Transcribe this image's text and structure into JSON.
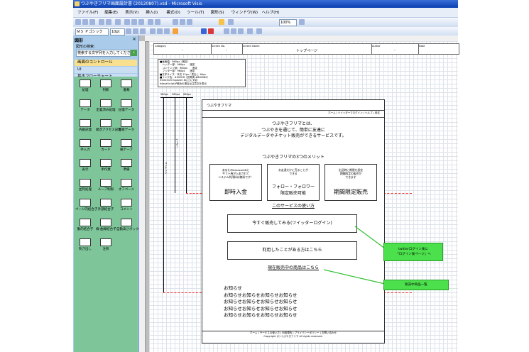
{
  "window": {
    "title": "つぶやきフリマ画面設計書 (20120807).vsd - Microsoft Visio"
  },
  "menu": [
    "ファイル(F)",
    "編集(E)",
    "表示(V)",
    "挿入(I)",
    "書式(O)",
    "ツール(T)",
    "図形(S)",
    "ウィンドウ(W)",
    "ヘルプ(H)"
  ],
  "toolbar": {
    "font_name": "ＭＳ Ｐゴシック",
    "font_size": "10pt",
    "zoom": "100%"
  },
  "shapes_pane": {
    "title": "図形",
    "find_label": "図形の検索:",
    "find_placeholder": "検索する文字列を入力してください",
    "stencils": [
      "画面のコントロール",
      "UI",
      "基本フローチャート"
    ],
    "shapes": [
      "処理",
      "判断",
      "書類",
      "データ",
      "定義済み処理",
      "記憶データ",
      "内部記憶",
      "順次アクセス記憶",
      "直接データ",
      "手入力",
      "カード",
      "紙テープ",
      "表示",
      "手作業",
      "準備",
      "並列処理",
      "ループ制限",
      "オフページ",
      "ページ内結合子",
      "外部結合子",
      "コメント",
      "動的結合子",
      "線-曲線結合子",
      "自動高さボックス",
      "吹き出し",
      "注釈"
    ]
  },
  "header_table": {
    "cols": [
      {
        "key": "Category",
        "value": "-"
      },
      {
        "key": "Screen No.",
        "value": "-"
      },
      {
        "key": "Screen Name",
        "value": "トップページ"
      },
      {
        "key": "Author",
        "value": "-"
      },
      {
        "key": "Date",
        "value": ""
      }
    ]
  },
  "spec_box": [
    "■画面幅：960px（固定）",
    "　ヘッダー部：960px　　固定",
    "　コンテンツ部：960px　　固定",
    "　フッター部：960px　　固定",
    "■文字サイズ：本文 12px / 見出し 16px",
    "■リンク色：#0000ff（訪問済 #800080）",
    "※Internet Explorer 8以上に対応",
    "※JavaScriptが無効の場合は注意文を表示"
  ],
  "mockup": {
    "logo": "つぶやきフリマ",
    "nav": "ホーム | ツイッターでログイン | ヘルプ | 設定",
    "intro": [
      "つぶやきフリマとは、",
      "つぶやきを通じて、簡単に友達に",
      "デジタルデータやチケット販売ができるサービスです。"
    ],
    "merit_title": "つぶやきフリマの3つのメリット",
    "merits": [
      {
        "text": "あなたのAmazonIDに\nギフト券が入金されて\nシステム利用料は無料です！",
        "title": "即時入金"
      },
      {
        "text": "お友達だけに売ることが\nできる",
        "title": "フォロー・フォロワー\n限定販売可能"
      },
      {
        "text": "出品時に期限を設定\n期間限定の販売が\nできます",
        "title": "期間限定販売"
      }
    ],
    "howto": "このサービスの使い方",
    "btn_sell": "今すぐ販売してみる(ツイッターログイン)",
    "btn_login": "利用したことがある方はこちら",
    "items_link": "現在販売中の商品はこちら",
    "news": [
      "お知らせ",
      "お知らせお知らせお知らせお知らせ",
      "お知らせお知らせお知らせお知らせ",
      "お知らせお知らせお知らせお知らせ",
      "お知らせお知らせお知らせお知らせ"
    ],
    "footer": [
      "ホーム | サービスの使い方 | 利用規約 | プライバシーポリシー | お問い合わせ",
      "Copyright (C) つぶやきフリマ All rights reserved."
    ]
  },
  "dimensions": [
    "960px",
    "960px",
    "960px"
  ],
  "dim_vertical": [
    "ヘッダー",
    "コンテンツ",
    "フッター"
  ],
  "notes": [
    "twitterログイン後に\n「ログイン後ページ」へ",
    "販売中商品一覧"
  ]
}
